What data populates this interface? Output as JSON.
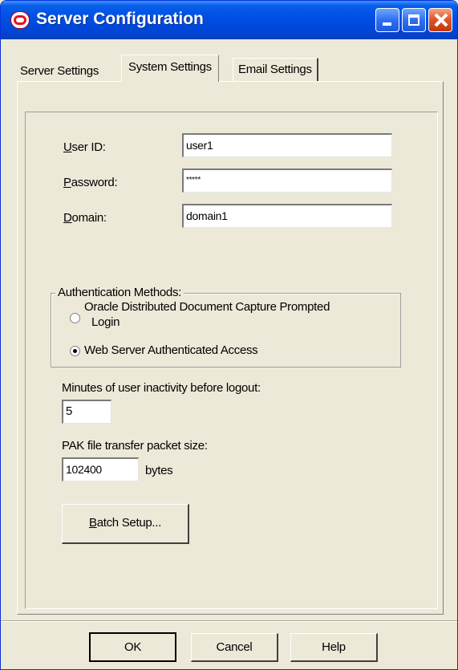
{
  "window": {
    "title": "Server Configuration"
  },
  "tabs": [
    {
      "label": "Server Settings",
      "active": false
    },
    {
      "label": "System Settings",
      "active": true
    },
    {
      "label": "Email Settings",
      "active": false
    }
  ],
  "credentials": {
    "user_id": {
      "label_prefix": "U",
      "label_rest": "ser ID:",
      "value": "user1"
    },
    "password": {
      "label_prefix": "P",
      "label_rest": "assword:",
      "value": "*****"
    },
    "domain": {
      "label_prefix": "D",
      "label_rest": "omain:",
      "value": "domain1"
    }
  },
  "auth_methods": {
    "legend": "Authentication Methods:",
    "options": [
      {
        "label_line1": "Oracle Distributed Document Capture Prompted",
        "label_line2": "Login",
        "selected": false
      },
      {
        "label_line1": "Web Server Authenticated Access",
        "selected": true
      }
    ]
  },
  "inactivity": {
    "label": "Minutes of user inactivity before logout:",
    "value": "5"
  },
  "pak": {
    "label": "PAK file transfer packet size:",
    "value": "102400",
    "unit": "bytes"
  },
  "batch_button": {
    "prefix": "B",
    "rest": "atch Setup..."
  },
  "footer": {
    "ok": "OK",
    "cancel": "Cancel",
    "help": "Help"
  }
}
